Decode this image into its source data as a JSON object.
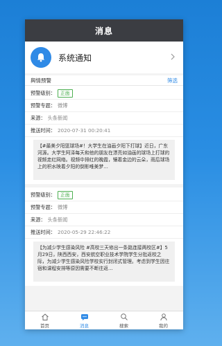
{
  "header": {
    "title": "消息"
  },
  "system": {
    "label": "系统通知"
  },
  "section": {
    "title": "舆情预警",
    "filter": "筛选"
  },
  "labels": {
    "level": "预警级别：",
    "topic": "预警专题：",
    "source": "来源：",
    "time": "推送时间："
  },
  "cards": [
    {
      "level": "正面",
      "topic": "微博",
      "source": "头条新闻",
      "time": "2020-07-31 00:20:41",
      "excerpt": "【#最美夕阳篮球场#！大学生在油画夕阳下打球】近日，广东河源。大学生阿泽每天和他的朋友在漂亮如油画的球场上打球的视频走红网络。视频中排红的晚霞，镶着金边的云朵，雨后球场上的积水映着夕阳的倒影唯美梦…"
    },
    {
      "level": "正面",
      "topic": "微博",
      "source": "头条新闻",
      "time": "2020-05-29 22:46:22",
      "excerpt": "【为减少学生感染风险 #高校三天修出一条路连接两校区#】5月29日，陕西西安，西安航空职业技术学院学生分批返校之际，为减少学生感染风险学校实行封闭式管理。考虑到学生因往宿和课程安排等原因需要不断往返…"
    }
  ],
  "tabs": [
    {
      "label": "首页",
      "icon": "home-icon"
    },
    {
      "label": "消息",
      "icon": "message-icon"
    },
    {
      "label": "搜索",
      "icon": "search-icon"
    },
    {
      "label": "我的",
      "icon": "user-icon"
    }
  ],
  "colors": {
    "accent": "#2f8ae6",
    "badge": "#4caf50",
    "titlebar": "#3b3d42"
  }
}
